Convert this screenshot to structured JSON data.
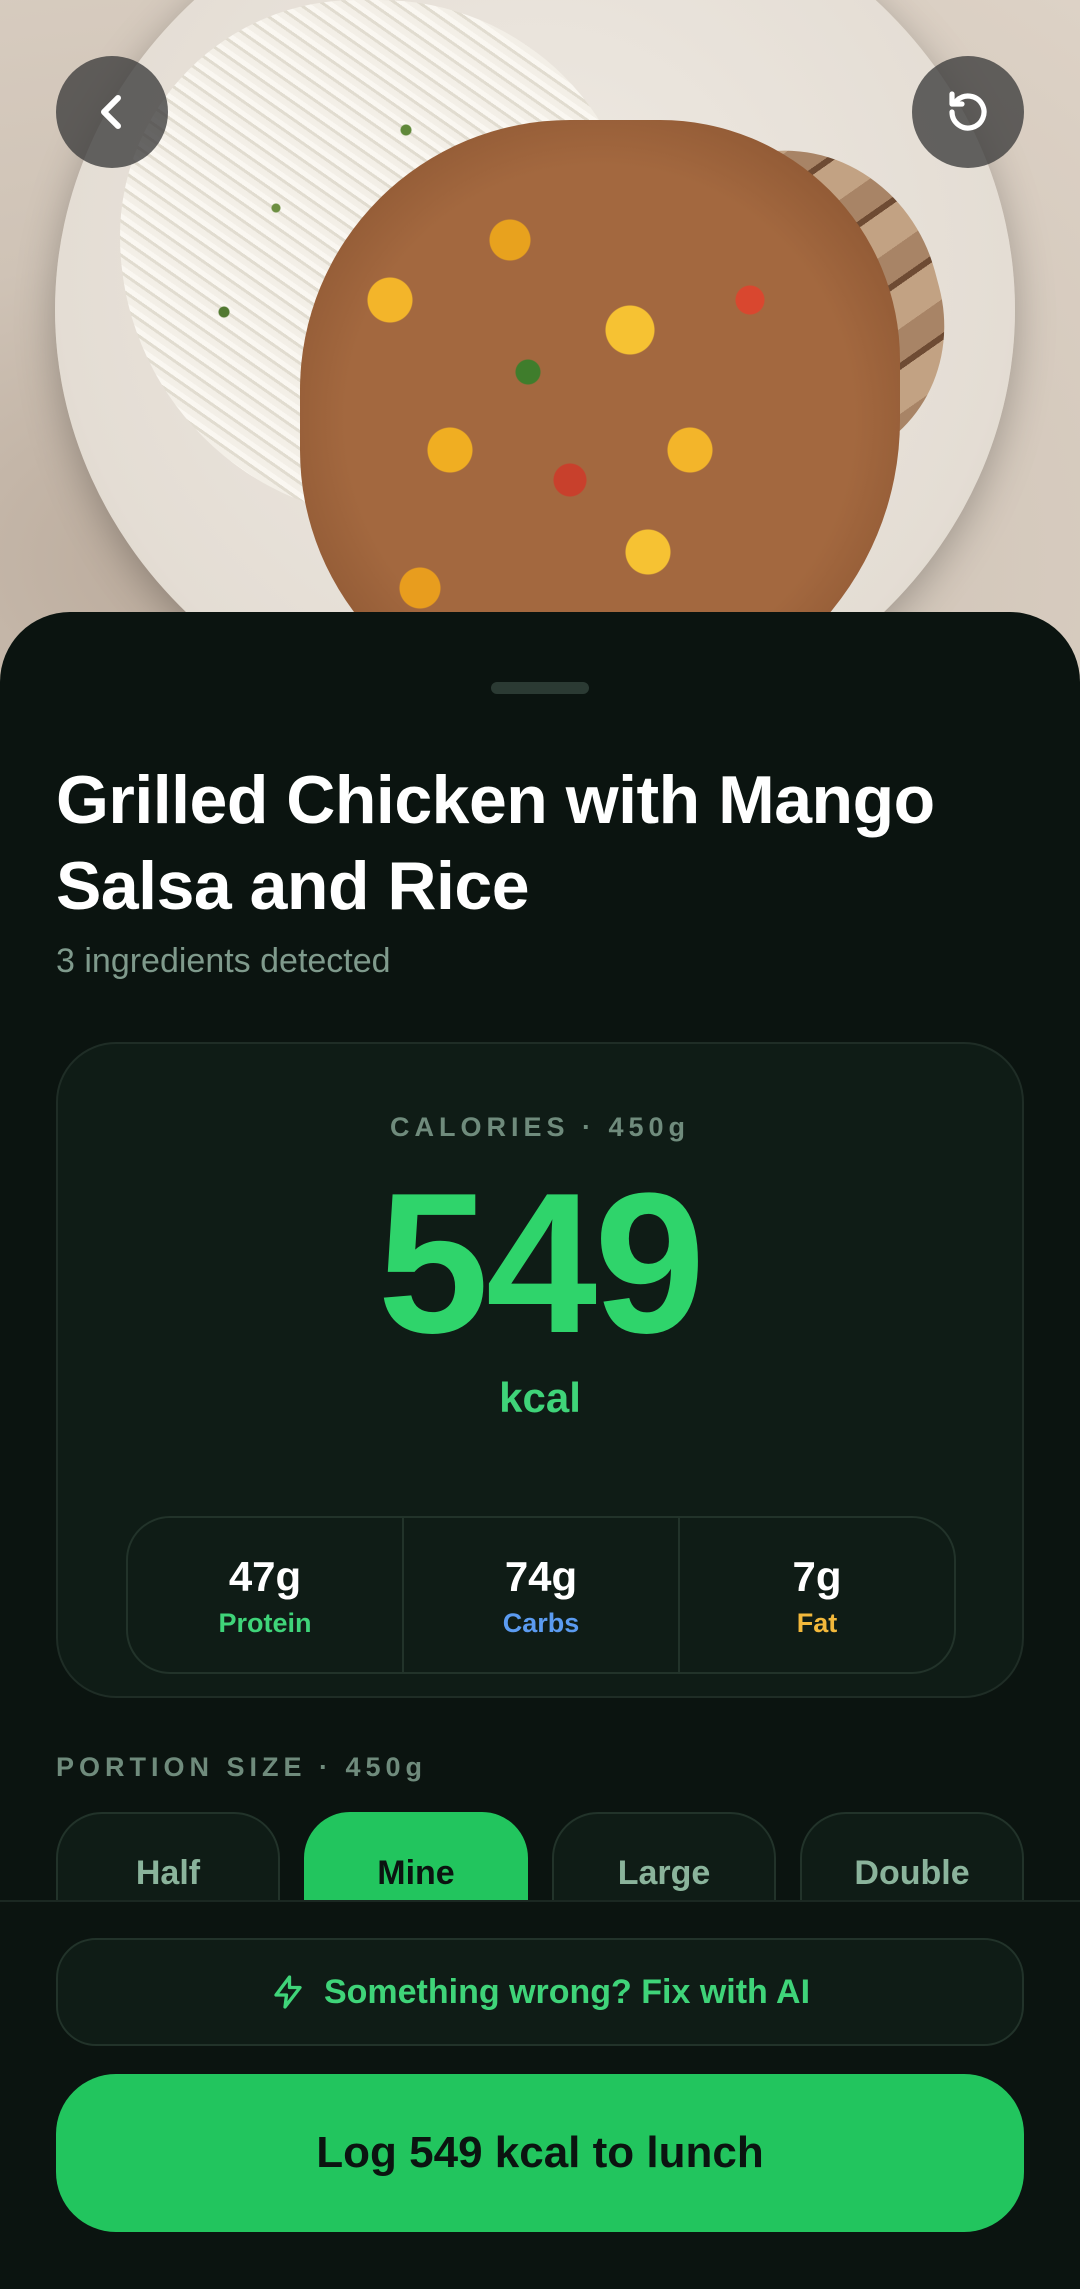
{
  "header": {
    "back_icon": "chevron-left-icon",
    "reset_icon": "rotate-ccw-icon"
  },
  "meal": {
    "title": "Grilled Chicken with Mango Salsa and Rice",
    "subtitle": "3 ingredients detected"
  },
  "calories": {
    "label": "CALORIES · 450g",
    "value": "549",
    "unit": "kcal"
  },
  "macros": [
    {
      "value": "47g",
      "name": "Protein",
      "color": "#3fd479"
    },
    {
      "value": "74g",
      "name": "Carbs",
      "color": "#5b9bf0"
    },
    {
      "value": "7g",
      "name": "Fat",
      "color": "#f2b83b"
    }
  ],
  "portion": {
    "label": "PORTION SIZE · 450g",
    "options": [
      "Half",
      "Mine",
      "Large",
      "Double"
    ],
    "selected": "Mine"
  },
  "actions": {
    "fix_label": "Something wrong? Fix with AI",
    "fix_icon": "lightning-icon",
    "log_label": "Log 549 kcal to lunch"
  },
  "colors": {
    "accent": "#22c55e",
    "background": "#0b1410"
  }
}
